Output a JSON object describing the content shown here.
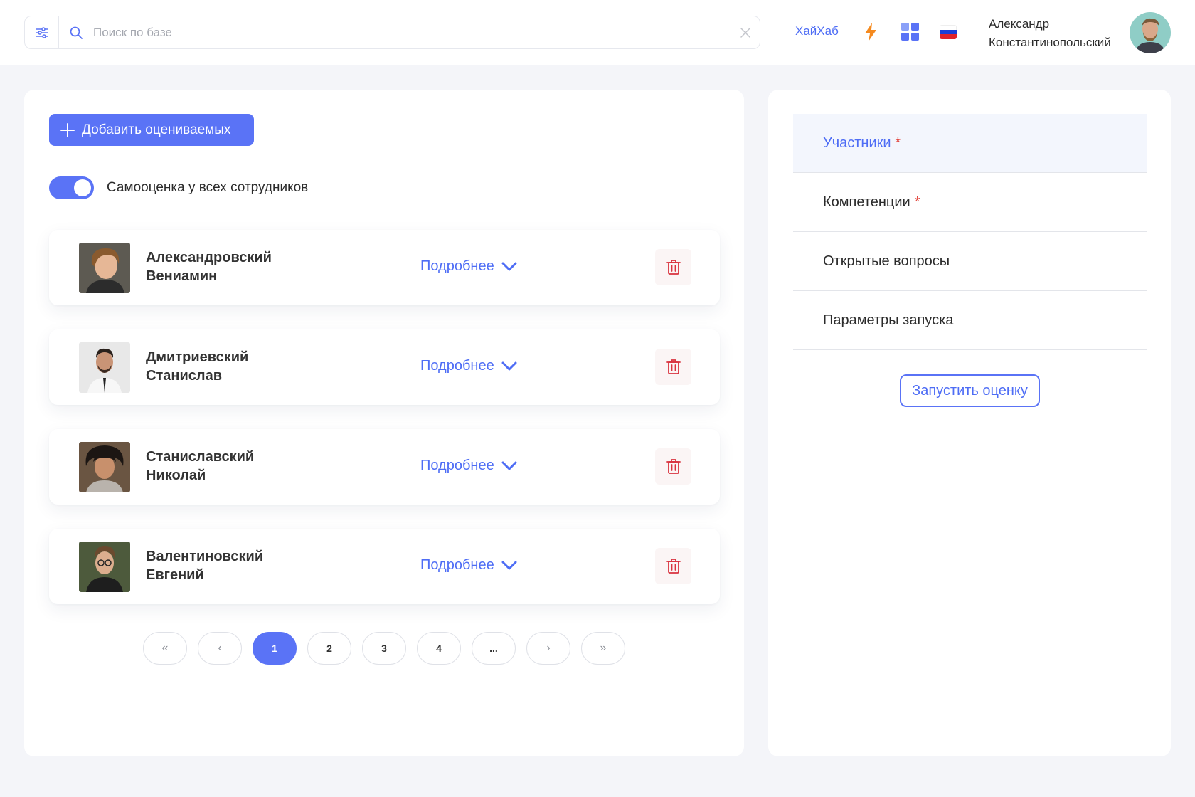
{
  "header": {
    "search_placeholder": "Поиск по базе",
    "hub_link": "ХайХаб",
    "user": {
      "first_name": "Александр",
      "last_name": "Константинопольский"
    }
  },
  "colors": {
    "accent": "#5a73f6",
    "danger": "#d9333f",
    "bolt": "#f58a1f"
  },
  "main": {
    "add_button": "Добавить оцениваемых",
    "self_assessment": {
      "label": "Самооценка у всех сотрудников",
      "enabled": true
    },
    "more_label": "Подробнее",
    "people": [
      {
        "last_name": "Александровский",
        "first_name": "Вениамин"
      },
      {
        "last_name": "Дмитриевский",
        "first_name": "Станислав"
      },
      {
        "last_name": "Станиславский",
        "first_name": "Николай"
      },
      {
        "last_name": "Валентиновский",
        "first_name": "Евгений"
      }
    ],
    "pagination": {
      "first": "«",
      "prev": "‹",
      "pages": [
        "1",
        "2",
        "3",
        "4",
        "..."
      ],
      "next": "›",
      "last": "»",
      "current": "1"
    }
  },
  "sidebar": {
    "steps": [
      {
        "label": "Участники",
        "required_mark": "*"
      },
      {
        "label": "Компетенции",
        "required_mark": "*"
      },
      {
        "label": "Открытые вопросы",
        "required_mark": ""
      },
      {
        "label": "Параметры запуска",
        "required_mark": ""
      }
    ],
    "active_step": "Участники",
    "launch_button": "Запустить оценку"
  }
}
